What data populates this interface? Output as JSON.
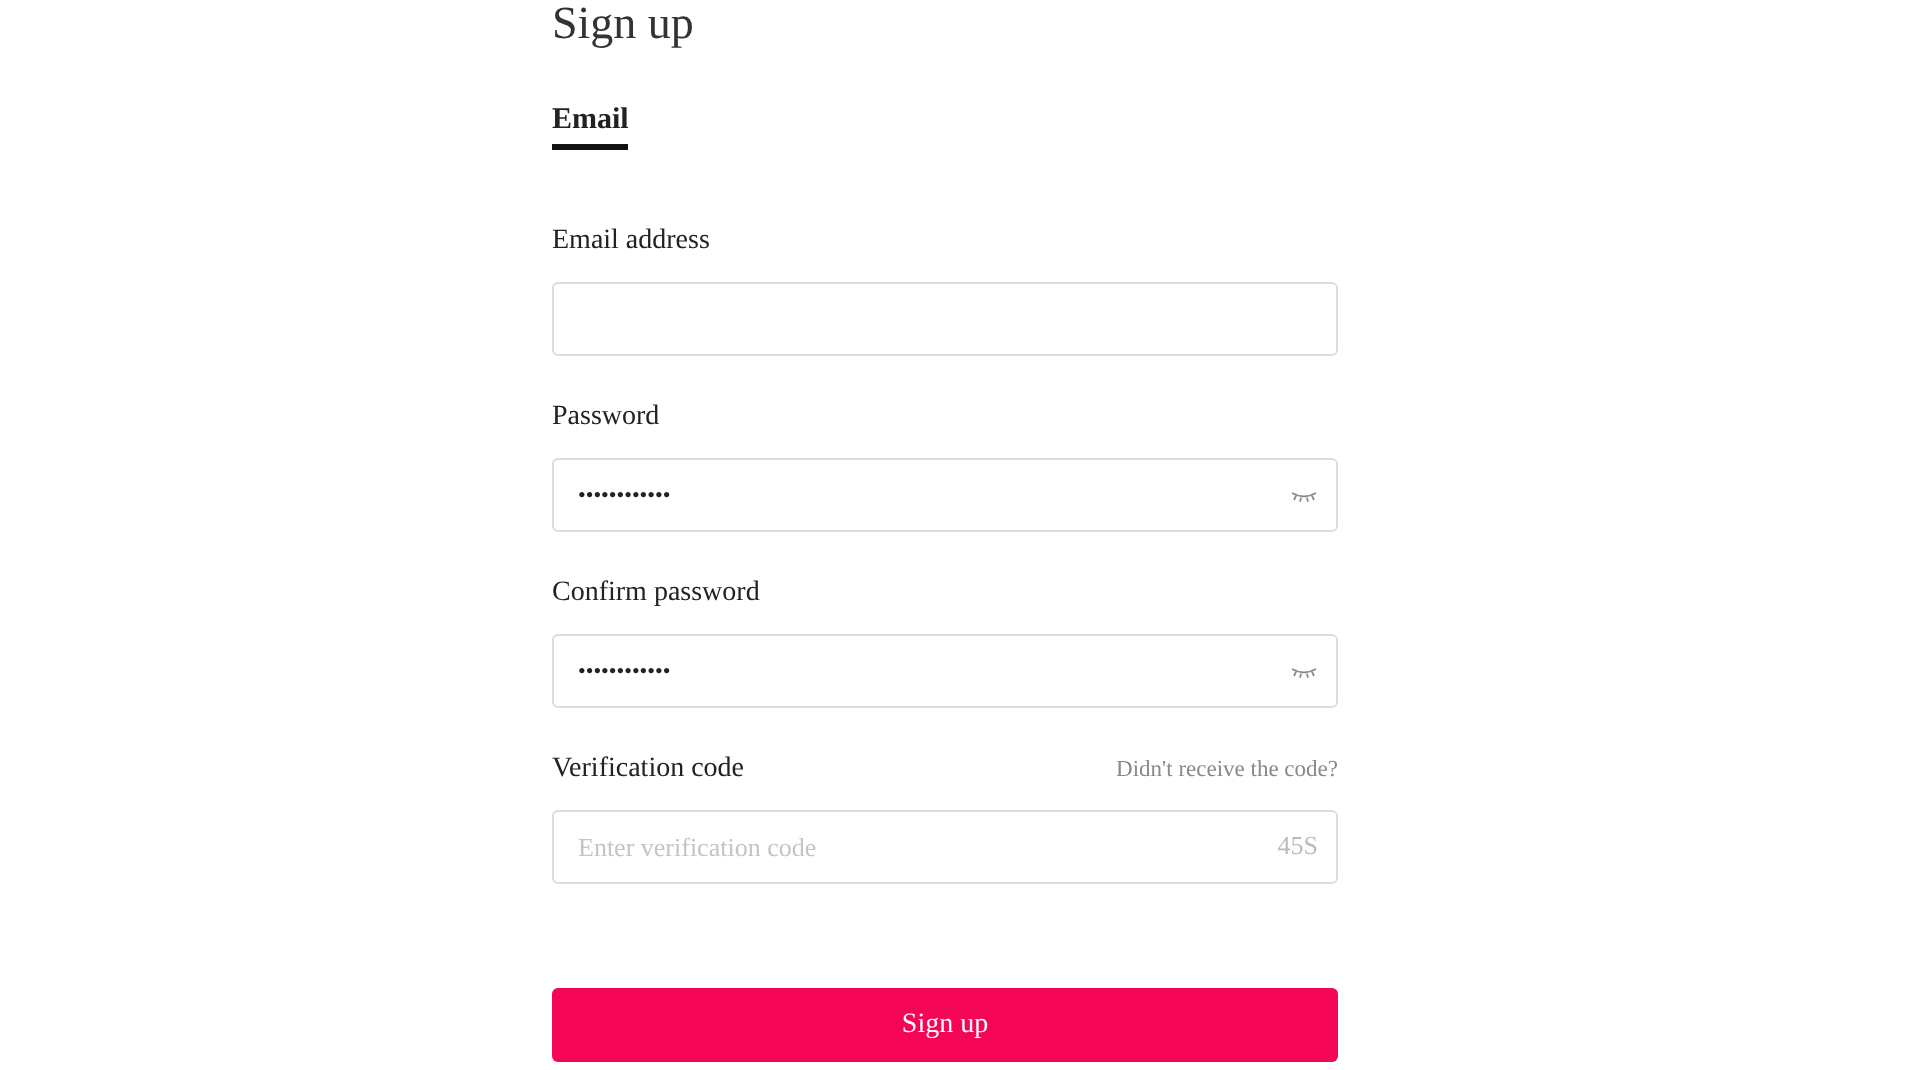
{
  "title": "Sign up",
  "tabs": [
    {
      "label": "Email",
      "selected": true
    }
  ],
  "fields": [
    {
      "kind": "text",
      "label": "Email address"
    },
    {
      "kind": "password",
      "label": "Password",
      "value": "••••••••••••"
    },
    {
      "kind": "password",
      "label": "Confirm password",
      "value": "••••••••••••"
    },
    {
      "kind": "code",
      "label": "Verification code",
      "link": "Didn't receive the code?",
      "placeholder": "Enter verification code",
      "countdown": "45S"
    }
  ],
  "button": "Sign up"
}
